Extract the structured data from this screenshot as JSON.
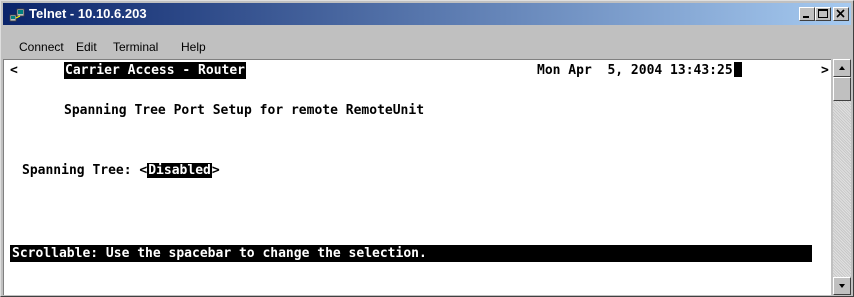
{
  "window": {
    "title": "Telnet - 10.10.6.203",
    "app_icon": "telnet-computer-icon"
  },
  "menu": {
    "connect": "Connect",
    "edit": "Edit",
    "terminal": "Terminal",
    "help": "Help"
  },
  "terminal": {
    "left_marker": "<",
    "right_marker": ">",
    "header_title": "Carrier Access - Router",
    "datetime": "Mon Apr  5, 2004 13:43:25",
    "screen_title": "Spanning Tree Port Setup for remote RemoteUnit",
    "field_label": "Spanning Tree:",
    "field_open": "<",
    "field_value": "Disabled",
    "field_close": ">",
    "status_message": "Scrollable: Use the spacebar to change the selection."
  },
  "colors": {
    "titlebar_start": "#0a246a",
    "titlebar_end": "#a6caf0",
    "terminal_bg": "#ffffff",
    "inverse_bg": "#000000"
  }
}
